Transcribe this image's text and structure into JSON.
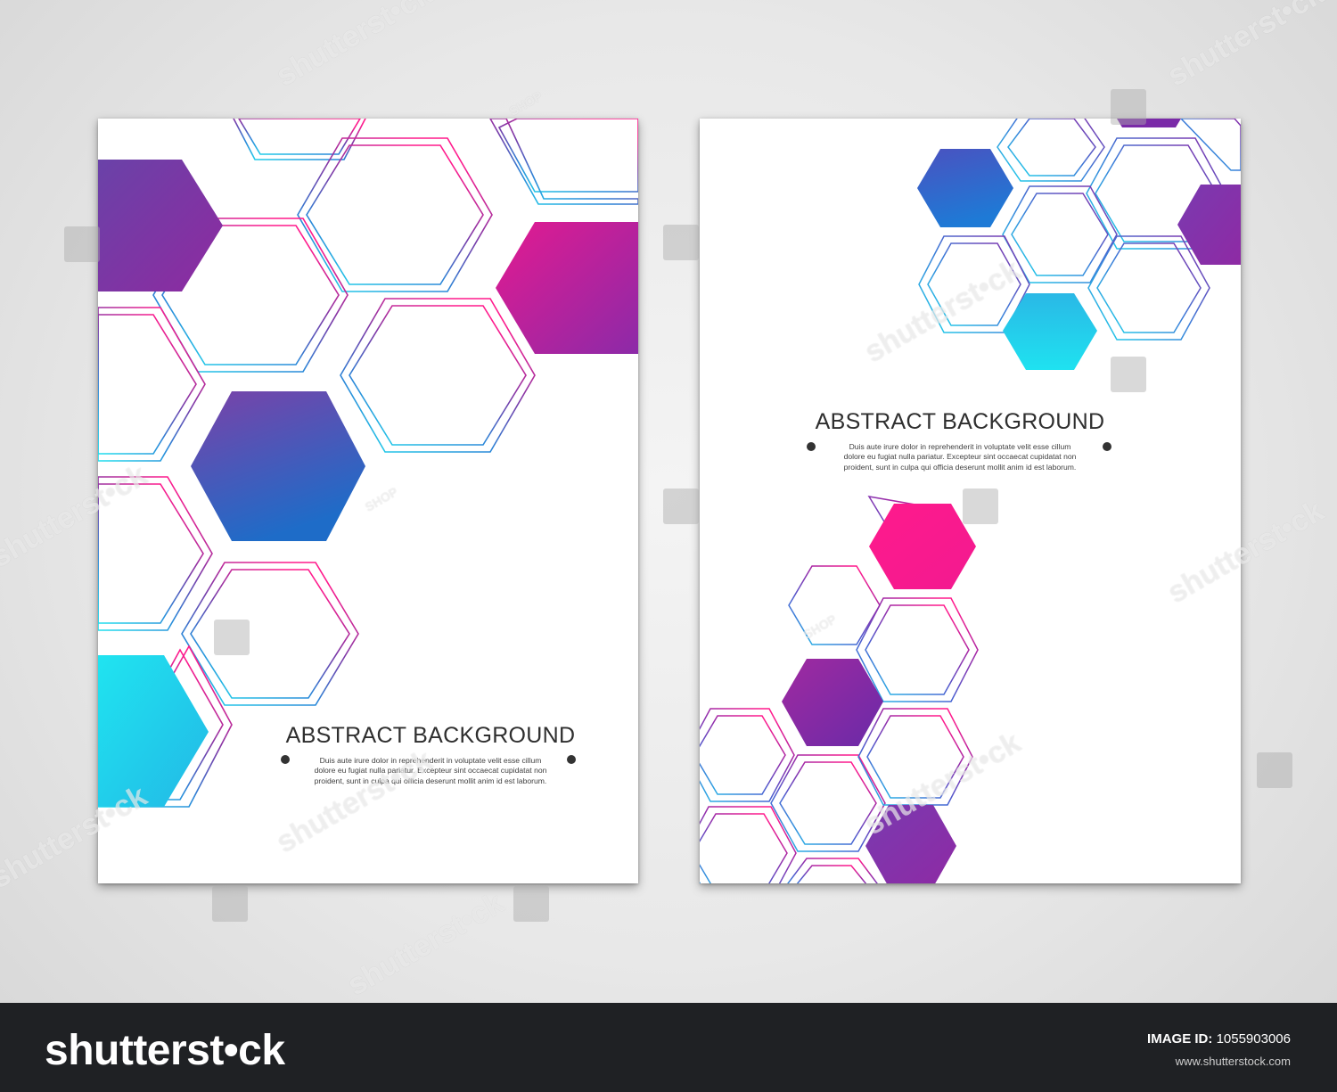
{
  "left_card": {
    "title": "ABSTRACT BACKGROUND",
    "body": [
      "Duis aute irure dolor in reprehenderit in voluptate velit esse cillum",
      "dolore eu fugiat nulla pariatur. Excepteur sint occaecat cupidatat non",
      "proident, sunt in culpa qui officia deserunt mollit anim id est laborum."
    ]
  },
  "right_card": {
    "title": "ABSTRACT BACKGROUND",
    "body": [
      "Duis aute irure dolor in reprehenderit in voluptate velit esse cillum",
      "dolore eu fugiat nulla pariatur. Excepteur sint occaecat cupidatat non",
      "proident, sunt in culpa qui officia deserunt mollit anim id est laborum."
    ]
  },
  "footer": {
    "logo": "shutterst•ck",
    "image_id_label": "IMAGE ID:",
    "image_id": "1055903006",
    "site": "www.shutterstock.com"
  },
  "watermarks": {
    "brand": "shutterst•ck",
    "shop": "SHOP"
  },
  "colors": {
    "cyan": "#1fd3ea",
    "blue": "#2f6fd0",
    "purple": "#7a3aa8",
    "magenta": "#ff1a8c",
    "ink": "#333333",
    "footer": "#1f2124"
  }
}
